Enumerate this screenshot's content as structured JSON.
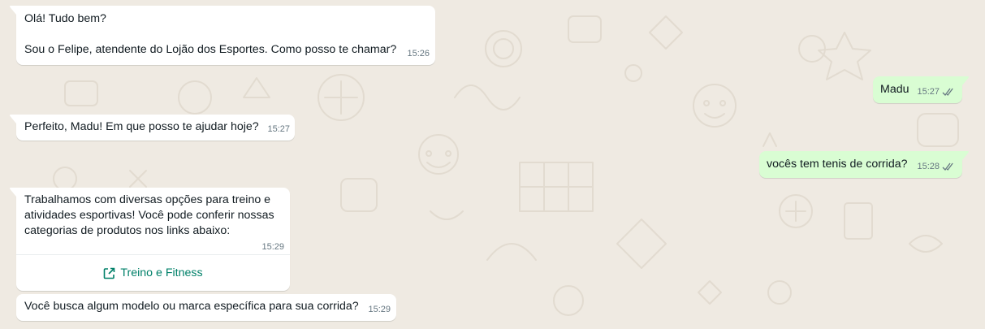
{
  "conversation": {
    "messages": [
      {
        "direction": "incoming",
        "lines": [
          "Olá! Tudo bem?",
          "",
          "Sou o Felipe, atendente do Lojão dos Esportes. Como posso te chamar?"
        ],
        "time": "15:26"
      },
      {
        "direction": "outgoing",
        "lines": [
          "Madu"
        ],
        "time": "15:27",
        "status": "read"
      },
      {
        "direction": "incoming",
        "lines": [
          "Perfeito, Madu! Em que posso te ajudar hoje?"
        ],
        "time": "15:27"
      },
      {
        "direction": "outgoing",
        "lines": [
          "vocês tem tenis de corrida?"
        ],
        "time": "15:28",
        "status": "read"
      },
      {
        "direction": "incoming",
        "lines": [
          "Trabalhamos com diversas opções para treino e",
          "atividades esportivas! Você pode conferir nossas",
          "categorias de produtos nos links abaixo:"
        ],
        "time": "15:29",
        "button": {
          "label": "Treino e Fitness",
          "icon": "external-link-icon"
        }
      },
      {
        "direction": "incoming",
        "lines": [
          "Você busca algum modelo ou marca específica para sua corrida?"
        ],
        "time": "15:29"
      }
    ]
  },
  "colors": {
    "background": "#efeae2",
    "incoming_bubble": "#ffffff",
    "outgoing_bubble": "#d9fdd3",
    "read_ticks": "#667781",
    "link": "#008069"
  }
}
